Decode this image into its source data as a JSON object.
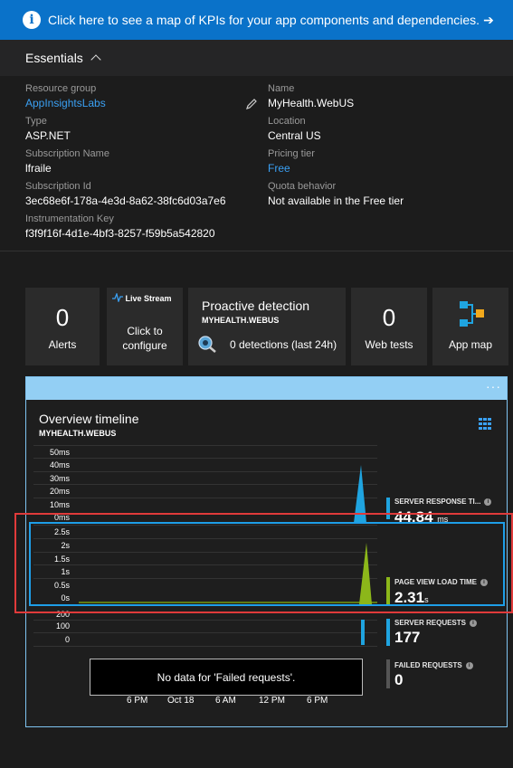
{
  "banner": {
    "text": "Click here to see a map of KPIs for your app components and dependencies.",
    "arrow": "➔"
  },
  "essentials": {
    "title": "Essentials"
  },
  "properties": {
    "resource_group_label": "Resource group",
    "resource_group_value": "AppInsightsLabs",
    "type_label": "Type",
    "type_value": "ASP.NET",
    "subscription_name_label": "Subscription Name",
    "subscription_name_value": "lfraile",
    "subscription_id_label": "Subscription Id",
    "subscription_id_value": "3ec68e6f-178a-4e3d-8a62-38fc6d03a7e6",
    "instrumentation_key_label": "Instrumentation Key",
    "instrumentation_key_value": "f3f9f16f-4d1e-4bf3-8257-f59b5a542820",
    "name_label": "Name",
    "name_value": "MyHealth.WebUS",
    "location_label": "Location",
    "location_value": "Central US",
    "pricing_tier_label": "Pricing tier",
    "pricing_tier_value": "Free",
    "quota_label": "Quota behavior",
    "quota_value": "Not available in the Free tier"
  },
  "tiles": {
    "alerts_count": "0",
    "alerts_label": "Alerts",
    "live_stream_title": "Live Stream",
    "live_stream_sub1": "Click to",
    "live_stream_sub2": "configure",
    "proactive_title": "Proactive detection",
    "proactive_sub": "MYHEALTH.WEBUS",
    "proactive_detections": "0 detections (last 24h)",
    "webtests_count": "0",
    "webtests_label": "Web tests",
    "appmap_label": "App map"
  },
  "timeline": {
    "title": "Overview timeline",
    "subtitle": "MYHEALTH.WEBUS",
    "dots": "···",
    "ms_ticks": [
      "50ms",
      "40ms",
      "30ms",
      "20ms",
      "10ms",
      "0ms"
    ],
    "s_ticks": [
      "2.5s",
      "2s",
      "1.5s",
      "1s",
      "0.5s",
      "0s"
    ],
    "req_ticks": [
      "200",
      "100",
      "0"
    ],
    "server_response_label": "SERVER RESPONSE TI...",
    "server_response_value": "44.84",
    "server_response_unit": "ms",
    "page_view_label": "PAGE VIEW LOAD TIME",
    "page_view_value": "2.31",
    "page_view_unit": "s",
    "server_requests_label": "SERVER REQUESTS",
    "server_requests_value": "177",
    "failed_requests_label": "FAILED REQUESTS",
    "failed_requests_value": "0",
    "no_data": "No data for 'Failed requests'.",
    "x_ticks": [
      "6 PM",
      "Oct 18",
      "6 AM",
      "12 PM",
      "6 PM"
    ]
  },
  "colors": {
    "accent": "#0a72c9",
    "link": "#3aa0f3",
    "server_response": "#1fa4e0",
    "page_view": "#8cb71a",
    "highlight_red": "#e03a3a",
    "highlight_blue": "#1e9ee8"
  }
}
